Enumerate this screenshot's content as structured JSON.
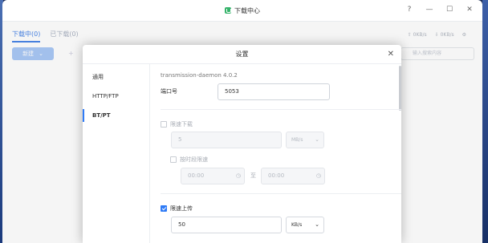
{
  "window": {
    "title": "下载中心",
    "controls": [
      "?",
      "—",
      "☐",
      "✕"
    ]
  },
  "tabs": [
    {
      "label": "下载中(0)",
      "active": true
    },
    {
      "label": "已下载(0)",
      "active": false
    }
  ],
  "speeds": {
    "upload": "0KB/s",
    "download": "0KB/s"
  },
  "toolbar": {
    "new_label": "新建",
    "search_placeholder": "输入搜索内容"
  },
  "dialog": {
    "title": "设置",
    "close": "✕",
    "sidebar": [
      {
        "label": "通用",
        "active": false
      },
      {
        "label": "HTTP/FTP",
        "active": false
      },
      {
        "label": "BT/PT",
        "active": true
      }
    ],
    "version": "transmission-daemon 4.0.2",
    "port": {
      "label": "端口号",
      "value": "5053"
    },
    "limit_download": {
      "label": "限速下载",
      "checked": false,
      "value": "5",
      "unit": "MB/s",
      "schedule": {
        "label": "按时段限速",
        "checked": false,
        "start": "00:00",
        "to": "至",
        "end": "00:00"
      }
    },
    "limit_upload": {
      "label": "限速上传",
      "checked": true,
      "value": "50",
      "unit": "KB/s"
    }
  },
  "colors": {
    "accent": "#2f7bf6",
    "tab_active": "#4a86e8"
  }
}
